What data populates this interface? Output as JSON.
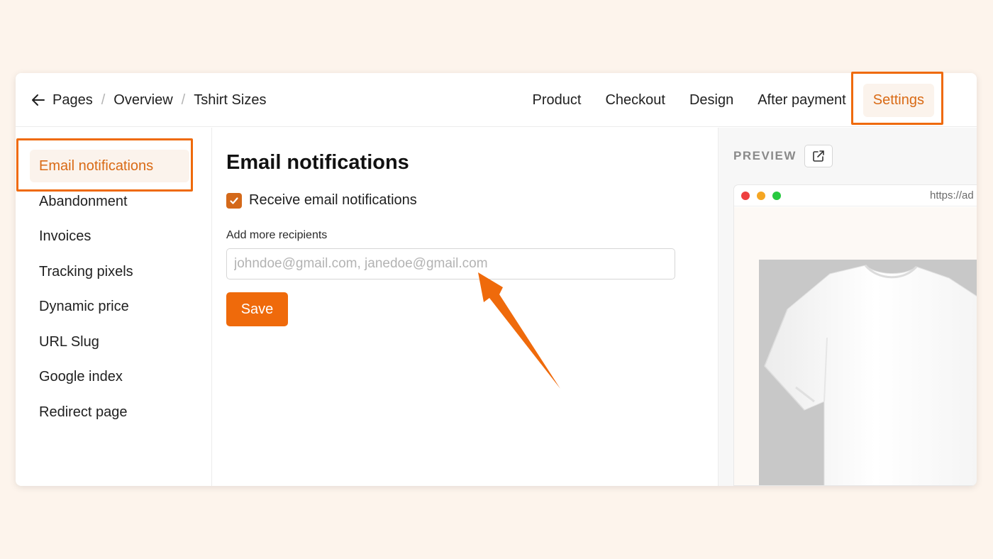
{
  "breadcrumb": {
    "items": [
      "Pages",
      "Overview",
      "Tshirt Sizes"
    ],
    "separator": "/"
  },
  "tabs": [
    {
      "label": "Product",
      "active": false
    },
    {
      "label": "Checkout",
      "active": false
    },
    {
      "label": "Design",
      "active": false
    },
    {
      "label": "After payment",
      "active": false
    },
    {
      "label": "Settings",
      "active": true
    }
  ],
  "sidebar": {
    "items": [
      {
        "label": "Email notifications",
        "active": true
      },
      {
        "label": "Abandonment",
        "active": false
      },
      {
        "label": "Invoices",
        "active": false
      },
      {
        "label": "Tracking pixels",
        "active": false
      },
      {
        "label": "Dynamic price",
        "active": false
      },
      {
        "label": "URL Slug",
        "active": false
      },
      {
        "label": "Google index",
        "active": false
      },
      {
        "label": "Redirect page",
        "active": false
      }
    ]
  },
  "main": {
    "title": "Email notifications",
    "checkbox_label": "Receive email notifications",
    "checkbox_checked": true,
    "field_label": "Add more recipients",
    "recipients_value": "",
    "recipients_placeholder": "johndoe@gmail.com, janedoe@gmail.com",
    "save_label": "Save"
  },
  "preview": {
    "label": "PREVIEW",
    "url": "https://ad",
    "image_subject": "white t-shirt"
  },
  "colors": {
    "accent": "#ef6a0b",
    "accent_text": "#d96a15",
    "active_bg": "#fbf3ec",
    "page_bg": "#fdf4ec",
    "traffic_red": "#ee3f3f",
    "traffic_yellow": "#f5a623",
    "traffic_green": "#27c93f"
  },
  "icons": [
    "back-arrow-icon",
    "checkmark-icon",
    "external-link-icon",
    "annotation-arrow-icon"
  ]
}
